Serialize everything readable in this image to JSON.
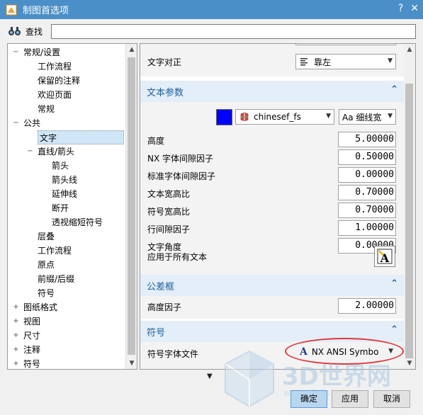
{
  "window": {
    "title": "制图首选项",
    "help_glyph": "?",
    "close_glyph": "✕"
  },
  "search": {
    "label": "查找",
    "value": "",
    "placeholder": ""
  },
  "tree": {
    "items": [
      {
        "label": "常规/设置",
        "expander": "−",
        "indent": 0
      },
      {
        "label": "工作流程",
        "expander": "",
        "indent": 1
      },
      {
        "label": "保留的注释",
        "expander": "",
        "indent": 1
      },
      {
        "label": "欢迎页面",
        "expander": "",
        "indent": 1
      },
      {
        "label": "常规",
        "expander": "",
        "indent": 1
      },
      {
        "label": "公共",
        "expander": "−",
        "indent": 0
      },
      {
        "label": "文字",
        "expander": "",
        "indent": 1,
        "selected": true
      },
      {
        "label": "直线/箭头",
        "expander": "−",
        "indent": 1
      },
      {
        "label": "箭头",
        "expander": "",
        "indent": 2
      },
      {
        "label": "箭头线",
        "expander": "",
        "indent": 2
      },
      {
        "label": "延伸线",
        "expander": "",
        "indent": 2
      },
      {
        "label": "断开",
        "expander": "",
        "indent": 2
      },
      {
        "label": "透视缩短符号",
        "expander": "",
        "indent": 2
      },
      {
        "label": "层叠",
        "expander": "",
        "indent": 1
      },
      {
        "label": "工作流程",
        "expander": "",
        "indent": 1
      },
      {
        "label": "原点",
        "expander": "",
        "indent": 1
      },
      {
        "label": "前缀/后缀",
        "expander": "",
        "indent": 1
      },
      {
        "label": "符号",
        "expander": "",
        "indent": 1
      },
      {
        "label": "图纸格式",
        "expander": "+",
        "indent": 0
      },
      {
        "label": "视图",
        "expander": "+",
        "indent": 0
      },
      {
        "label": "尺寸",
        "expander": "+",
        "indent": 0
      },
      {
        "label": "注释",
        "expander": "+",
        "indent": 0
      },
      {
        "label": "符号",
        "expander": "+",
        "indent": 0
      }
    ]
  },
  "text_alignment": {
    "label": "文字对正",
    "value": "靠左"
  },
  "text_params": {
    "title": "文本参数",
    "color": "#0000ff",
    "font_value": "chinesef_fs",
    "style_value": "Aa 细线宽",
    "rows": [
      {
        "label": "高度",
        "value": "5.00000"
      },
      {
        "label": "NX 字体间隙因子",
        "value": "0.50000"
      },
      {
        "label": "标准字体间隙因子",
        "value": "0.00000"
      },
      {
        "label": "文本宽高比",
        "value": "0.70000"
      },
      {
        "label": "符号宽高比",
        "value": "0.70000"
      },
      {
        "label": "行间隙因子",
        "value": "1.00000"
      },
      {
        "label": "文字角度",
        "value": "0.00000"
      }
    ],
    "apply_all_label": "应用于所有文本",
    "apply_all_icon": "A"
  },
  "tolerance": {
    "title": "公差框",
    "height_label": "高度因子",
    "height_value": "2.00000"
  },
  "symbols": {
    "title": "符号",
    "font_file_label": "符号字体文件",
    "font_file_value": "NX ANSI Symbo"
  },
  "buttons": {
    "ok": "确定",
    "apply": "应用",
    "cancel": "取消"
  },
  "watermark": {
    "text": "3D世界网",
    "subtext": "www.3dsjw.com"
  },
  "colors": {
    "titlebar": "#4a8fc7",
    "group_header": "#e3eef8",
    "group_title": "#1a5fa0",
    "selection": "#cfe6f7",
    "annotation": "#e0343c"
  }
}
